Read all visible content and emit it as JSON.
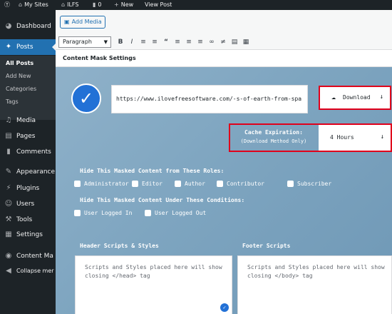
{
  "admin_bar": {
    "site_name": "My Sites",
    "site_short": "ILFS",
    "comments_count": "0",
    "new_label": "New",
    "view_post_label": "View Post"
  },
  "sidebar": {
    "items": [
      {
        "label": "Dashboard",
        "icon": "dashboard-icon"
      },
      {
        "label": "Posts",
        "icon": "pin-icon"
      },
      {
        "label": "Media",
        "icon": "media-icon"
      },
      {
        "label": "Pages",
        "icon": "pages-icon"
      },
      {
        "label": "Comments",
        "icon": "comments-icon"
      },
      {
        "label": "Appearance",
        "icon": "brush-icon"
      },
      {
        "label": "Plugins",
        "icon": "plugin-icon"
      },
      {
        "label": "Users",
        "icon": "users-icon"
      },
      {
        "label": "Tools",
        "icon": "tools-icon"
      },
      {
        "label": "Settings",
        "icon": "settings-icon"
      },
      {
        "label": "Content Ma",
        "icon": "content-mask-icon"
      },
      {
        "label": "Collapse mer",
        "icon": "collapse-icon"
      }
    ],
    "posts_submenu": [
      "All Posts",
      "Add New",
      "Categories",
      "Tags"
    ]
  },
  "editor": {
    "add_media_label": "Add Media",
    "format_select": "Paragraph",
    "metabox_title": "Content Mask Settings"
  },
  "content_mask": {
    "url": "https://www.ilovefreesoftware.com/-s-of-earth-from-spa",
    "method_label": "Download",
    "cache_title": "Cache Expiration:",
    "cache_subtitle": "(Download Method Only)",
    "cache_value": "4 Hours",
    "roles_title": "Hide This Masked Content from These Roles:",
    "roles": [
      "Administrator",
      "Editor",
      "Author",
      "Contributor",
      "Subscriber"
    ],
    "conditions_title": "Hide This Masked Content Under These Conditions:",
    "conditions": [
      "User Logged In",
      "User Logged Out"
    ],
    "header_scripts_title": "Header Scripts & Styles",
    "header_scripts_placeholder": "Scripts and Styles placed here will show closing </head> tag",
    "footer_scripts_title": "Footer Scripts",
    "footer_scripts_placeholder": "Scripts and Styles placed here will show closing </body> tag"
  },
  "colors": {
    "accent": "#2271b1",
    "highlight": "#e0001b",
    "sidebar_bg": "#1d2327"
  }
}
